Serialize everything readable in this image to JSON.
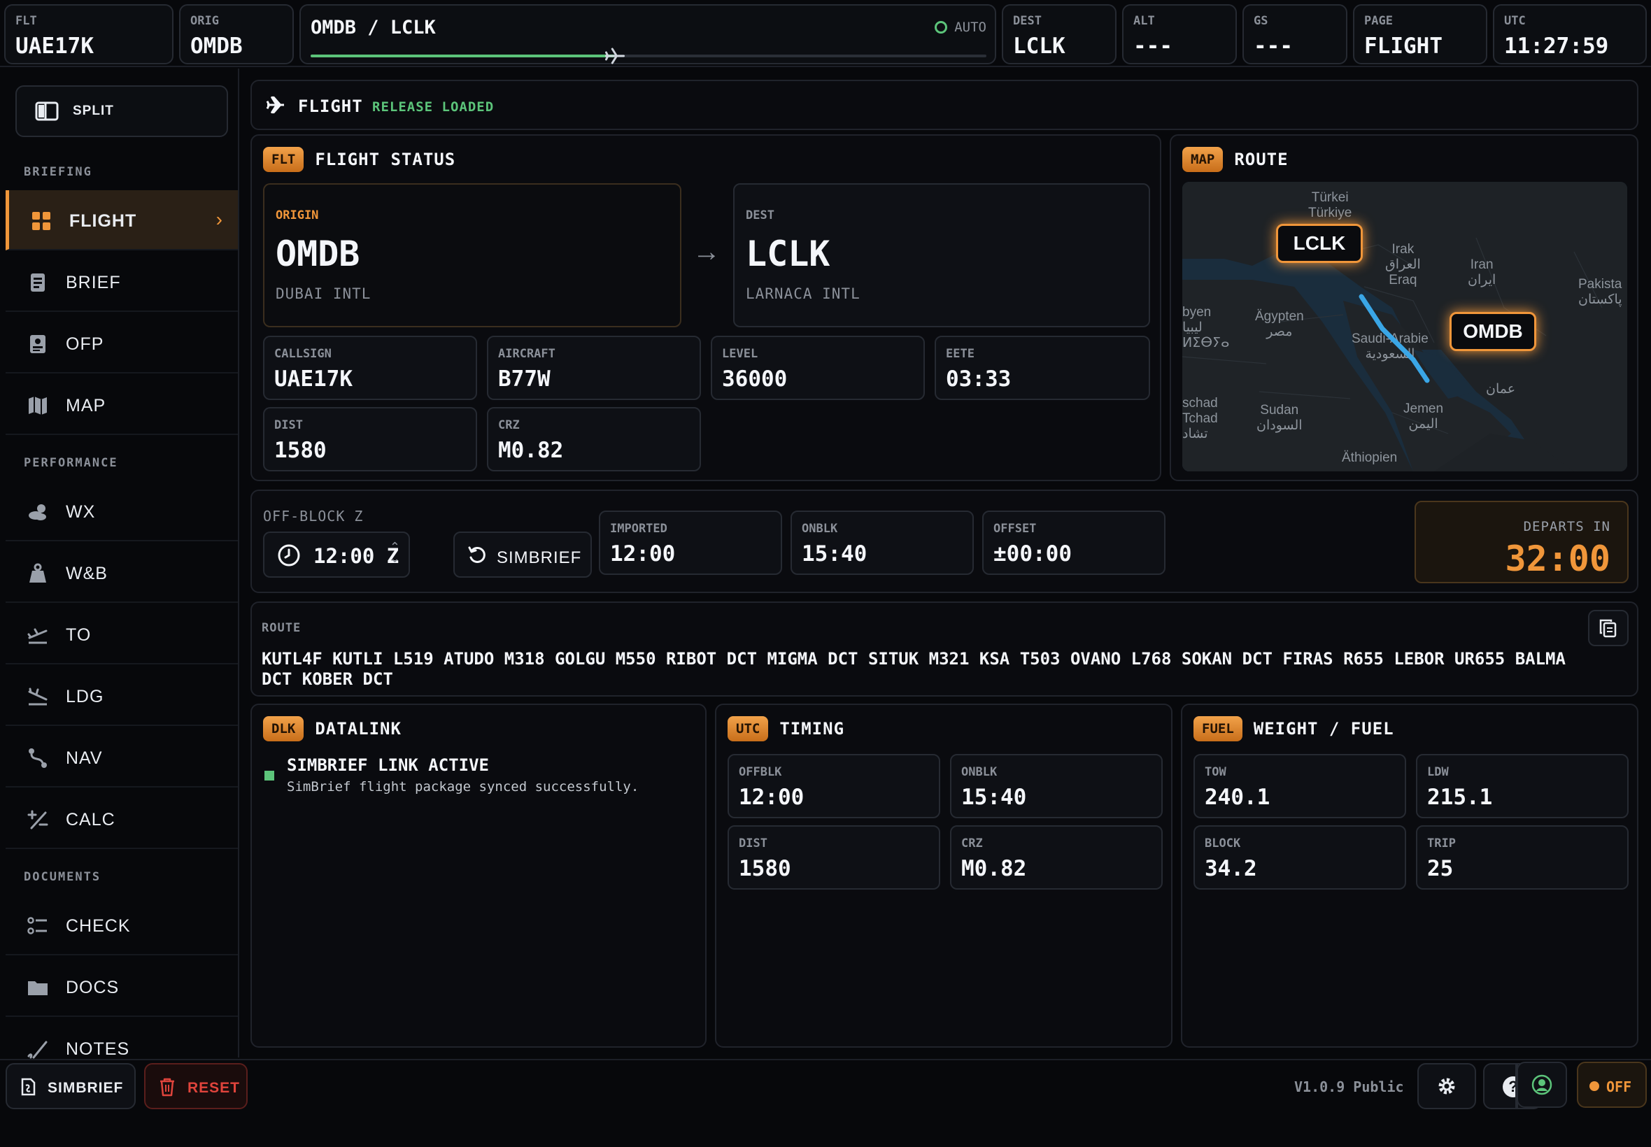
{
  "topbar": {
    "flt": {
      "label": "FLT",
      "value": "UAE17K"
    },
    "orig": {
      "label": "ORIG",
      "value": "OMDB"
    },
    "route": {
      "label": "OMDB / LCLK",
      "mode": "AUTO",
      "progress": 0.45
    },
    "dest": {
      "label": "DEST",
      "value": "LCLK"
    },
    "alt": {
      "label": "ALT",
      "value": "---"
    },
    "gs": {
      "label": "GS",
      "value": "---"
    },
    "page": {
      "label": "PAGE",
      "value": "FLIGHT"
    },
    "utc": {
      "label": "UTC",
      "value": "11:27:59"
    }
  },
  "sidebar": {
    "split_label": "SPLIT",
    "sections": {
      "briefing": "BRIEFING",
      "performance": "PERFORMANCE",
      "documents": "DOCUMENTS"
    },
    "items": [
      {
        "label": "FLIGHT",
        "icon": "grid-icon",
        "active": true
      },
      {
        "label": "BRIEF",
        "icon": "clipboard-icon"
      },
      {
        "label": "OFP",
        "icon": "document-icon"
      },
      {
        "label": "MAP",
        "icon": "map-icon"
      },
      {
        "label": "WX",
        "icon": "weather-icon"
      },
      {
        "label": "W&B",
        "icon": "weight-icon"
      },
      {
        "label": "TO",
        "icon": "takeoff-icon"
      },
      {
        "label": "LDG",
        "icon": "landing-icon"
      },
      {
        "label": "NAV",
        "icon": "route-icon"
      },
      {
        "label": "CALC",
        "icon": "calculator-icon"
      },
      {
        "label": "CHECK",
        "icon": "checklist-icon"
      },
      {
        "label": "DOCS",
        "icon": "folder-icon"
      },
      {
        "label": "NOTES",
        "icon": "pen-icon"
      }
    ]
  },
  "header": {
    "title": "FLIGHT",
    "status": "RELEASE LOADED"
  },
  "flight_status": {
    "badge": "FLT",
    "title": "FLIGHT STATUS",
    "origin": {
      "label": "ORIGIN",
      "code": "OMDB",
      "name": "DUBAI INTL"
    },
    "dest": {
      "label": "DEST",
      "code": "LCLK",
      "name": "LARNACA INTL"
    },
    "callsign": {
      "label": "CALLSIGN",
      "value": "UAE17K"
    },
    "aircraft": {
      "label": "AIRCRAFT",
      "value": "B77W"
    },
    "level": {
      "label": "LEVEL",
      "value": "36000"
    },
    "eete": {
      "label": "EETE",
      "value": "03:33"
    },
    "dist": {
      "label": "DIST",
      "value": "1580"
    },
    "crz": {
      "label": "CRZ",
      "value": "M0.82"
    }
  },
  "map": {
    "badge": "MAP",
    "title": "ROUTE",
    "origin_label": "OMDB",
    "dest_label": "LCLK",
    "place_names": {
      "turkey1": "Türkei",
      "turkey2": "Türkiye",
      "iraq1": "Irak",
      "iraq2": "العراق",
      "iraq3": "Eraq",
      "iran1": "Iran",
      "iran2": "ایران",
      "pak1": "Pakista",
      "pak2": "پاکستان",
      "egypt1": "Ägypten",
      "egypt2": "مصر",
      "libya1": "byen",
      "libya2": "ليبيا",
      "libya3": "ⵍⵉⴱⵢⴰ",
      "saudi1": "Saudi-Arabie",
      "saudi2": "السعودية",
      "chad1": "schad",
      "chad2": "Tchad",
      "chad3": "تشاد",
      "sudan1": "Sudan",
      "sudan2": "السودان",
      "yemen1": "Jemen",
      "yemen2": "اليمن",
      "oman": "عمان",
      "ethiopia": "Äthiopien"
    }
  },
  "offblock": {
    "label": "OFF-BLOCK Z",
    "time": "12:00 Z",
    "simbrief_button": "SIMBRIEF",
    "imported": {
      "label": "IMPORTED",
      "value": "12:00"
    },
    "onblk": {
      "label": "ONBLK",
      "value": "15:40"
    },
    "offset": {
      "label": "OFFSET",
      "value": "±00:00"
    },
    "departs": {
      "label": "DEPARTS IN",
      "value": "32:00"
    }
  },
  "route": {
    "label": "ROUTE",
    "line1": "KUTL4F KUTLI L519 ATUDO M318 GOLGU M550 RIBOT DCT MIGMA DCT SITUK M321 KSA T503 OVANO L768 SOKAN DCT FIRAS R655 LEBOR UR655 BALMA",
    "line2": "DCT KOBER DCT"
  },
  "datalink": {
    "badge": "DLK",
    "title": "DATALINK",
    "message_title": "SIMBRIEF LINK ACTIVE",
    "message_body": "SimBrief flight package synced successfully."
  },
  "timing": {
    "badge": "UTC",
    "title": "TIMING",
    "offblk": {
      "label": "OFFBLK",
      "value": "12:00"
    },
    "onblk": {
      "label": "ONBLK",
      "value": "15:40"
    },
    "dist": {
      "label": "DIST",
      "value": "1580"
    },
    "crz": {
      "label": "CRZ",
      "value": "M0.82"
    }
  },
  "fuel": {
    "badge": "FUEL",
    "title": "WEIGHT / FUEL",
    "tow": {
      "label": "TOW",
      "value": "240.1"
    },
    "ldw": {
      "label": "LDW",
      "value": "215.1"
    },
    "block": {
      "label": "BLOCK",
      "value": "34.2"
    },
    "trip": {
      "label": "TRIP",
      "value": "25"
    }
  },
  "bottombar": {
    "simbrief": "SIMBRIEF",
    "reset": "RESET",
    "version": "V1.0.9 Public",
    "status": "OFF"
  },
  "colors": {
    "accent": "#f0963a",
    "ok": "#5cc47a",
    "danger": "#e0443c",
    "route": "#3aa6e6"
  }
}
